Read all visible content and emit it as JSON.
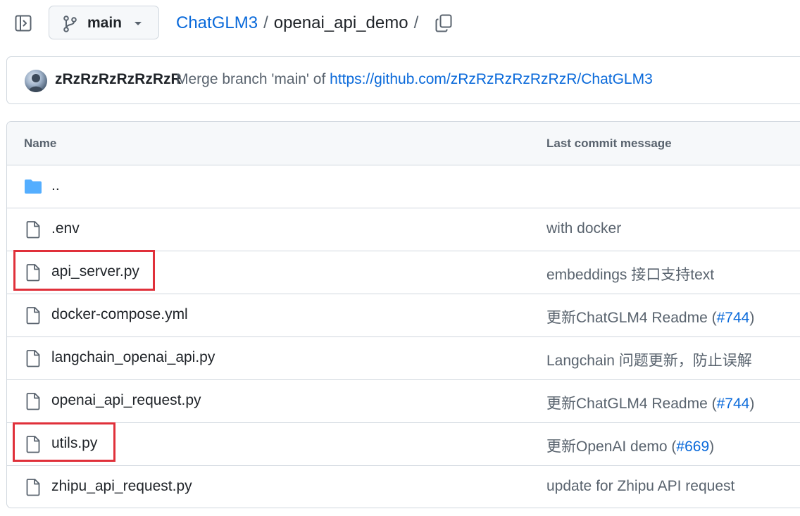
{
  "header": {
    "branch": "main",
    "repo": "ChatGLM3",
    "separator": "/",
    "directory": "openai_api_demo",
    "trailing_separator": "/"
  },
  "commit": {
    "author": "zRzRzRzRzRzRzR",
    "message_prefix": "Merge branch 'main' of",
    "message_link": "https://github.com/zRzRzRzRzRzRzR/ChatGLM3"
  },
  "table": {
    "columns": [
      "Name",
      "Last commit message"
    ],
    "rows": [
      {
        "name": "..",
        "type": "folder",
        "msg_text": "",
        "msg_link": "",
        "msg_suffix": ""
      },
      {
        "name": ".env",
        "type": "file",
        "msg_text": "with docker",
        "msg_link": "",
        "msg_suffix": ""
      },
      {
        "name": "api_server.py",
        "type": "file",
        "msg_text": "embeddings 接口支持text",
        "msg_link": "",
        "msg_suffix": "",
        "highlighted": true
      },
      {
        "name": "docker-compose.yml",
        "type": "file",
        "msg_text": "更新ChatGLM4 Readme (",
        "msg_link": "#744",
        "msg_suffix": ")"
      },
      {
        "name": "langchain_openai_api.py",
        "type": "file",
        "msg_text": "Langchain 问题更新，防止误解",
        "msg_link": "",
        "msg_suffix": ""
      },
      {
        "name": "openai_api_request.py",
        "type": "file",
        "msg_text": "更新ChatGLM4 Readme (",
        "msg_link": "#744",
        "msg_suffix": ")"
      },
      {
        "name": "utils.py",
        "type": "file",
        "msg_text": "更新OpenAI demo (",
        "msg_link": "#669",
        "msg_suffix": ")",
        "highlighted": true
      },
      {
        "name": "zhipu_api_request.py",
        "type": "file",
        "msg_text": "update for Zhipu API request",
        "msg_link": "",
        "msg_suffix": ""
      }
    ]
  },
  "colors": {
    "link": "#0969da",
    "muted": "#59636e",
    "folder": "#54aeff",
    "highlight": "#e0303a"
  },
  "icons": [
    "sidebar-toggle-icon",
    "git-branch-icon",
    "caret-down-icon",
    "copy-icon",
    "folder-icon",
    "file-icon"
  ]
}
